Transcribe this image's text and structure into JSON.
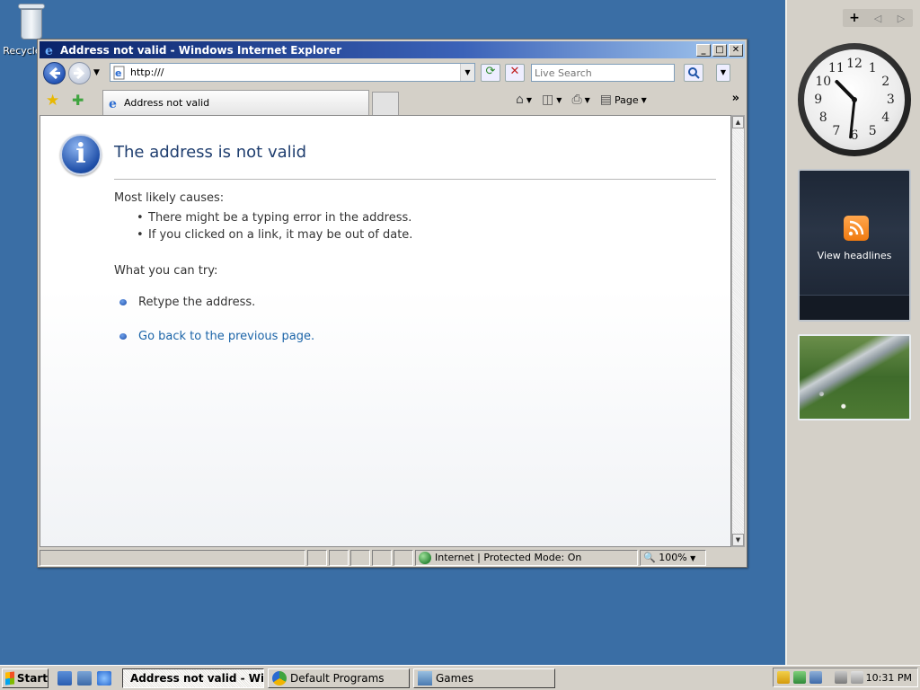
{
  "desktop": {
    "recycle_label": "Recycle Bin"
  },
  "sidebar": {
    "add_button": "+",
    "prev_button": "◁",
    "next_button": "▷",
    "clock": {
      "numerals": [
        "12",
        "1",
        "2",
        "3",
        "4",
        "5",
        "6",
        "7",
        "8",
        "9",
        "10",
        "11"
      ],
      "time": "10:31"
    },
    "feed_label": "View headlines"
  },
  "browser": {
    "title": "Address not valid - Windows Internet Explorer",
    "address": "http:///",
    "search_placeholder": "Live Search",
    "tab_title": "Address not valid",
    "page_menu": "Page",
    "content": {
      "heading": "The address is not valid",
      "causes_heading": "Most likely causes:",
      "causes": [
        "There might be a typing error in the address.",
        "If you clicked on a link, it may be out of date."
      ],
      "try_heading": "What you can try:",
      "try_items": [
        "Retype the address.",
        "Go back to the previous page."
      ]
    },
    "status": {
      "zone": "Internet | Protected Mode: On",
      "zoom": "100%"
    }
  },
  "taskbar": {
    "start_label": "Start",
    "tasks": [
      {
        "label": "Address not valid - Wi...",
        "active": true
      },
      {
        "label": "Default Programs",
        "active": false
      },
      {
        "label": "Games",
        "active": false
      }
    ],
    "clock": "10:31 PM"
  },
  "colors": {
    "desktop": "#3a6ea5",
    "titlebar_start": "#0a246a",
    "link": "#1b64a8",
    "heading": "#1f3e6f"
  }
}
